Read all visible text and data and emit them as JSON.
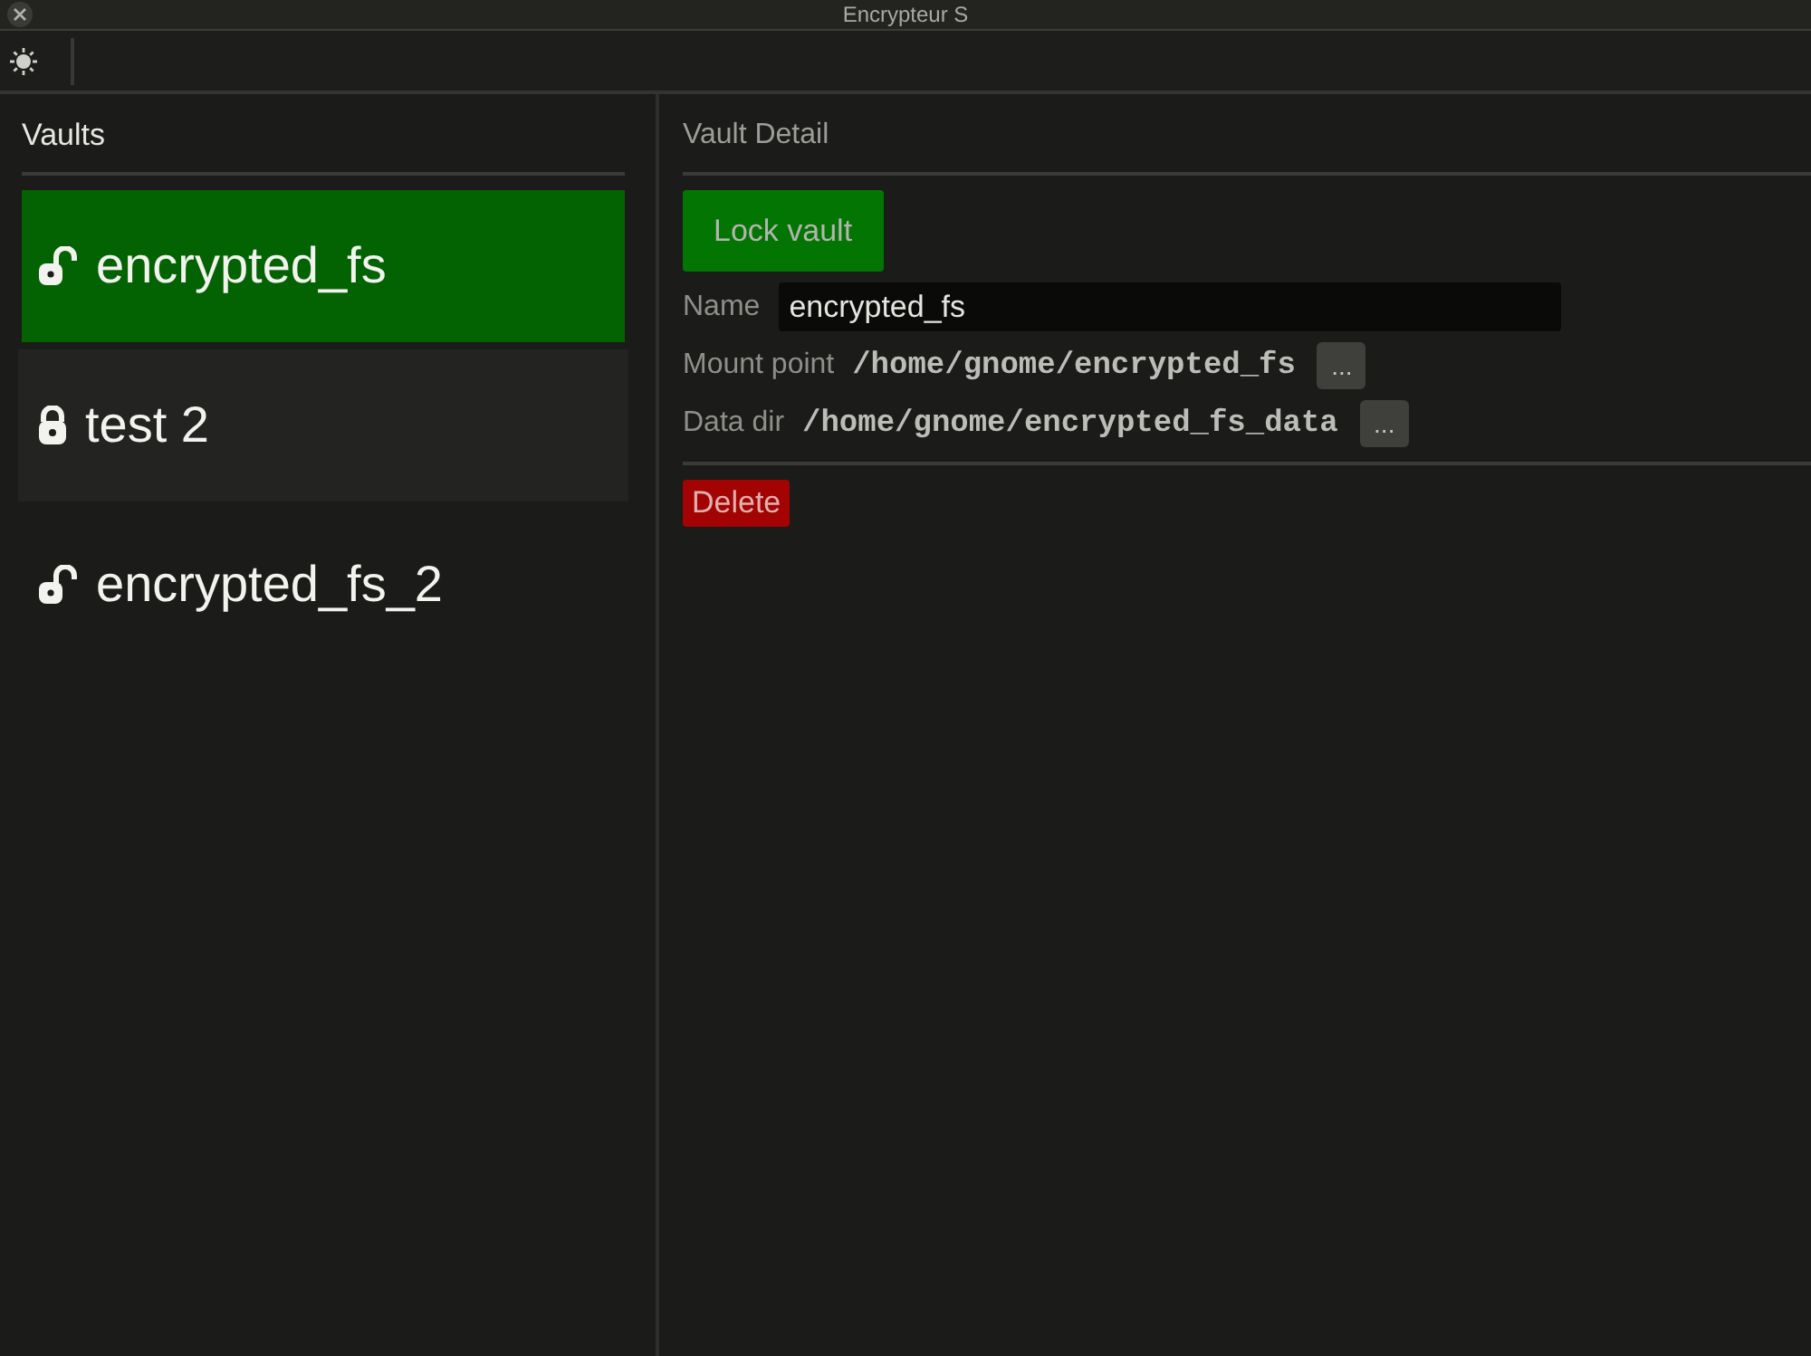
{
  "window": {
    "title": "Encrypteur S"
  },
  "vaults": {
    "heading": "Vaults",
    "items": [
      {
        "name": "encrypted_fs",
        "locked": false,
        "selected": true,
        "hovered": false
      },
      {
        "name": "test 2",
        "locked": true,
        "selected": false,
        "hovered": true
      },
      {
        "name": "encrypted_fs_2",
        "locked": false,
        "selected": false,
        "hovered": false
      }
    ]
  },
  "detail": {
    "heading": "Vault Detail",
    "lock_button": "Lock vault",
    "fields": [
      {
        "kind": "input",
        "label": "Name",
        "value": "encrypted_fs"
      },
      {
        "kind": "path",
        "label": "Mount point",
        "value": "/home/gnome/encrypted_fs",
        "button": "..."
      },
      {
        "kind": "path",
        "label": "Data dir",
        "value": "/home/gnome/encrypted_fs_data",
        "button": "..."
      }
    ],
    "delete_button": "Delete"
  }
}
